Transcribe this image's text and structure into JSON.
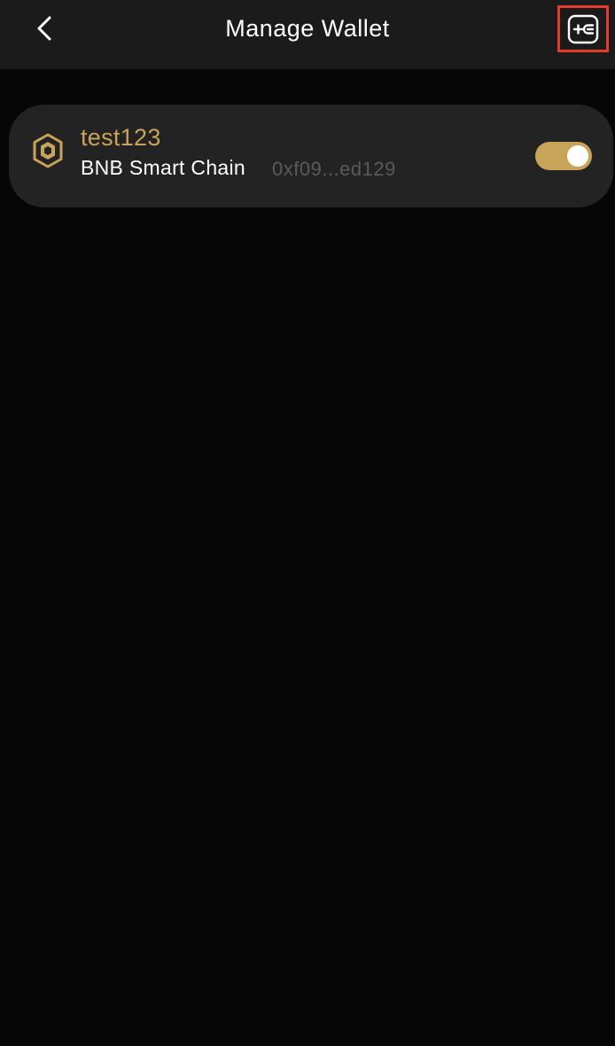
{
  "header": {
    "title": "Manage Wallet",
    "back_icon": "chevron-left-icon",
    "add_icon": "add-wallet-icon"
  },
  "wallets": [
    {
      "name": "test123",
      "chain": "BNB Smart Chain",
      "address": "0xf09...ed129",
      "chain_icon": "bnb-logo-icon",
      "enabled": true
    }
  ],
  "colors": {
    "background": "#060606",
    "header_bg": "#1b1b1b",
    "card_bg": "#232323",
    "accent_gold": "#c8a458",
    "address_gray": "#5a5a5a",
    "highlight_red": "#e53b2c"
  }
}
